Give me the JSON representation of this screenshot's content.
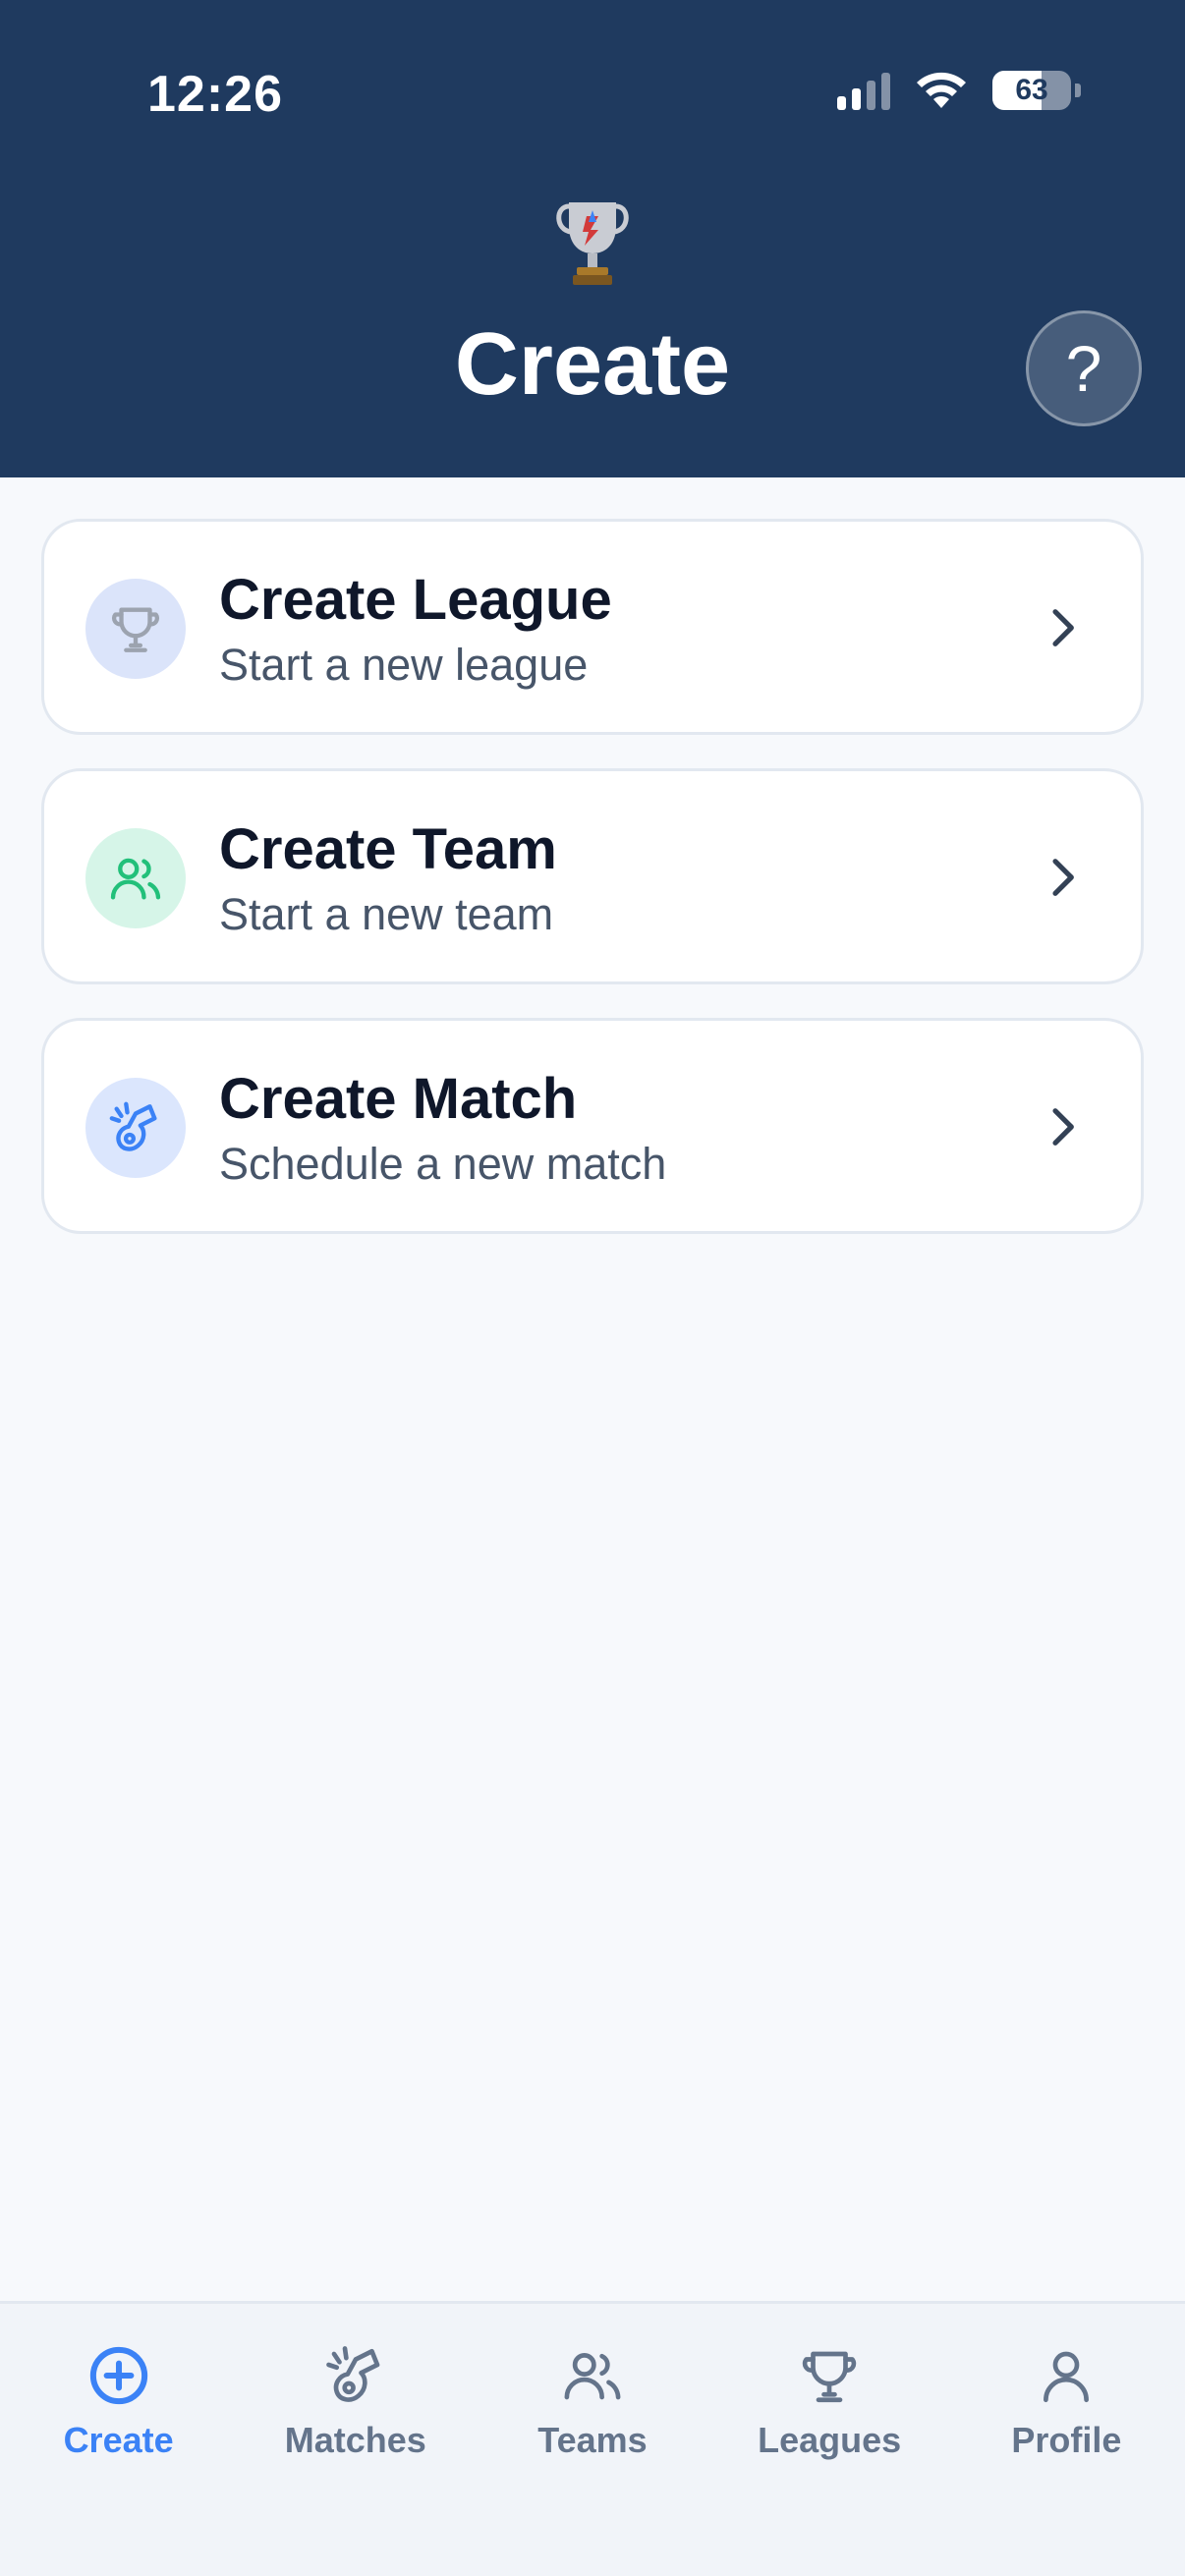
{
  "status_bar": {
    "time": "12:26",
    "battery": "63",
    "battery_level": 0.63
  },
  "header": {
    "logo_icon": "trophy-icon",
    "title": "Create",
    "help_label": "?"
  },
  "cards": [
    {
      "title": "Create League",
      "subtitle": "Start a new league",
      "icon": "trophy-icon",
      "icon_bg": "#dbe4fa",
      "icon_color": "#9ca3af"
    },
    {
      "title": "Create Team",
      "subtitle": "Start a new team",
      "icon": "users-icon",
      "icon_bg": "#d6f5e8",
      "icon_color": "#22c07a"
    },
    {
      "title": "Create Match",
      "subtitle": "Schedule a new match",
      "icon": "whistle-icon",
      "icon_bg": "#dbe6fd",
      "icon_color": "#3b82f6"
    }
  ],
  "tabs": [
    {
      "label": "Create",
      "icon": "plus-circle-icon",
      "active": true
    },
    {
      "label": "Matches",
      "icon": "whistle-icon",
      "active": false
    },
    {
      "label": "Teams",
      "icon": "users-icon",
      "active": false
    },
    {
      "label": "Leagues",
      "icon": "trophy-icon",
      "active": false
    },
    {
      "label": "Profile",
      "icon": "user-icon",
      "active": false
    }
  ],
  "colors": {
    "header_bg": "#1f3a5f",
    "accent": "#3b82f6",
    "inactive_tab": "#64748b"
  }
}
